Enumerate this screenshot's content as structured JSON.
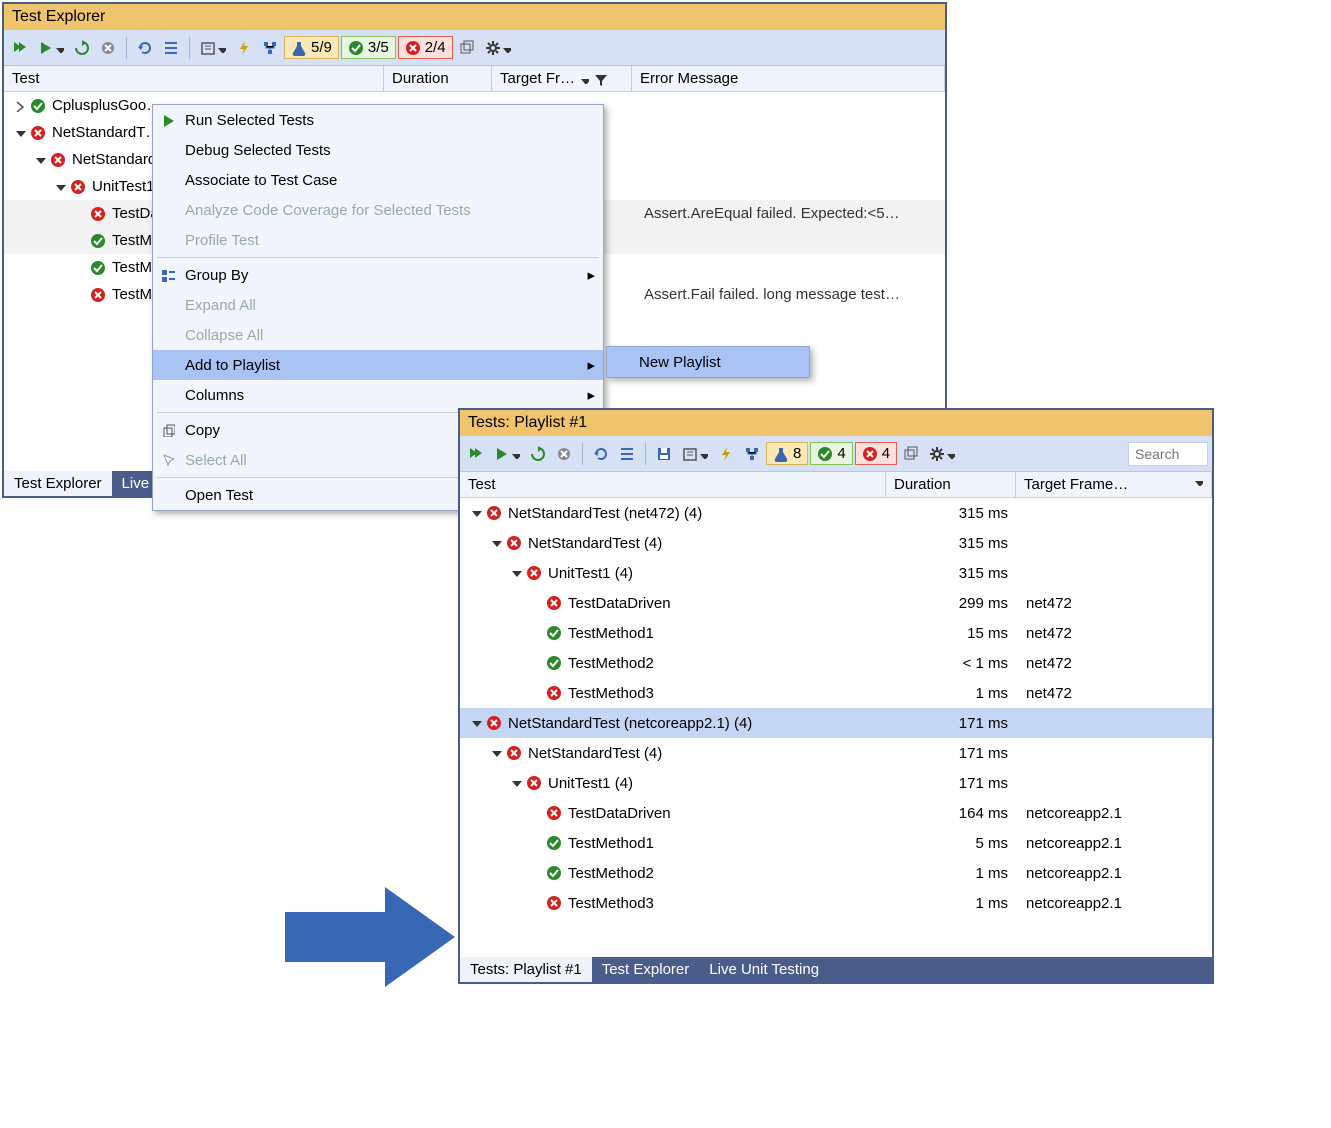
{
  "window1": {
    "title": "Test Explorer",
    "counts": {
      "run": "5/9",
      "pass": "3/5",
      "fail": "2/4"
    },
    "columns": {
      "test": "Test",
      "duration": "Duration",
      "target": "Target Fr…",
      "error": "Error Message"
    },
    "tree": [
      {
        "indent": 0,
        "expander": "right",
        "status": "pass",
        "name": "CplusplusGoo…"
      },
      {
        "indent": 0,
        "expander": "down",
        "status": "fail",
        "name": "NetStandardT…"
      },
      {
        "indent": 1,
        "expander": "down",
        "status": "fail",
        "name": "NetStandard…"
      },
      {
        "indent": 2,
        "expander": "down",
        "status": "fail",
        "name": "UnitTest1…"
      },
      {
        "indent": 3,
        "expander": "",
        "status": "fail",
        "name": "TestData…",
        "error": "Assert.AreEqual failed. Expected:<5…",
        "zebra": true
      },
      {
        "indent": 3,
        "expander": "",
        "status": "pass",
        "name": "TestMet…",
        "zebra": true
      },
      {
        "indent": 3,
        "expander": "",
        "status": "pass",
        "name": "TestMet…"
      },
      {
        "indent": 3,
        "expander": "",
        "status": "fail",
        "name": "TestMet…",
        "error": "Assert.Fail failed. long message test…"
      }
    ],
    "tabs": {
      "active": "Test Explorer",
      "other": "Live"
    }
  },
  "context_menu": {
    "items": [
      {
        "label": "Run Selected Tests",
        "icon": "play"
      },
      {
        "label": "Debug Selected Tests"
      },
      {
        "label": "Associate to Test Case"
      },
      {
        "label": "Analyze Code Coverage for Selected Tests",
        "disabled": true
      },
      {
        "label": "Profile Test",
        "disabled": true
      },
      {
        "sep": true
      },
      {
        "label": "Group By",
        "icon": "group",
        "submenu": true
      },
      {
        "label": "Expand All",
        "disabled": true
      },
      {
        "label": "Collapse All",
        "disabled": true
      },
      {
        "label": "Add to Playlist",
        "submenu": true,
        "highlight": true
      },
      {
        "label": "Columns",
        "submenu": true
      },
      {
        "sep": true
      },
      {
        "label": "Copy",
        "icon": "copy"
      },
      {
        "label": "Select All",
        "icon": "select",
        "disabled": true
      },
      {
        "sep": true
      },
      {
        "label": "Open Test"
      }
    ],
    "submenu": {
      "label": "New Playlist"
    }
  },
  "window2": {
    "title": "Tests: Playlist #1",
    "counts": {
      "run": "8",
      "pass": "4",
      "fail": "4"
    },
    "search_placeholder": "Search",
    "columns": {
      "test": "Test",
      "duration": "Duration",
      "target": "Target Frame…"
    },
    "tree": [
      {
        "indent": 0,
        "expander": "down",
        "status": "fail",
        "name": "NetStandardTest (net472)  (4)",
        "duration": "315 ms"
      },
      {
        "indent": 1,
        "expander": "down",
        "status": "fail",
        "name": "NetStandardTest  (4)",
        "duration": "315 ms"
      },
      {
        "indent": 2,
        "expander": "down",
        "status": "fail",
        "name": "UnitTest1  (4)",
        "duration": "315 ms"
      },
      {
        "indent": 3,
        "expander": "",
        "status": "fail",
        "name": "TestDataDriven",
        "duration": "299 ms",
        "target": "net472"
      },
      {
        "indent": 3,
        "expander": "",
        "status": "pass",
        "name": "TestMethod1",
        "duration": "15 ms",
        "target": "net472"
      },
      {
        "indent": 3,
        "expander": "",
        "status": "pass",
        "name": "TestMethod2",
        "duration": "< 1 ms",
        "target": "net472"
      },
      {
        "indent": 3,
        "expander": "",
        "status": "fail",
        "name": "TestMethod3",
        "duration": "1 ms",
        "target": "net472"
      },
      {
        "indent": 0,
        "expander": "down",
        "status": "fail",
        "name": "NetStandardTest (netcoreapp2.1)  (4)",
        "duration": "171 ms",
        "selected": true
      },
      {
        "indent": 1,
        "expander": "down",
        "status": "fail",
        "name": "NetStandardTest  (4)",
        "duration": "171 ms"
      },
      {
        "indent": 2,
        "expander": "down",
        "status": "fail",
        "name": "UnitTest1  (4)",
        "duration": "171 ms"
      },
      {
        "indent": 3,
        "expander": "",
        "status": "fail",
        "name": "TestDataDriven",
        "duration": "164 ms",
        "target": "netcoreapp2.1"
      },
      {
        "indent": 3,
        "expander": "",
        "status": "pass",
        "name": "TestMethod1",
        "duration": "5 ms",
        "target": "netcoreapp2.1"
      },
      {
        "indent": 3,
        "expander": "",
        "status": "pass",
        "name": "TestMethod2",
        "duration": "1 ms",
        "target": "netcoreapp2.1"
      },
      {
        "indent": 3,
        "expander": "",
        "status": "fail",
        "name": "TestMethod3",
        "duration": "1 ms",
        "target": "netcoreapp2.1"
      }
    ],
    "tabs": [
      "Tests: Playlist #1",
      "Test Explorer",
      "Live Unit Testing"
    ]
  }
}
